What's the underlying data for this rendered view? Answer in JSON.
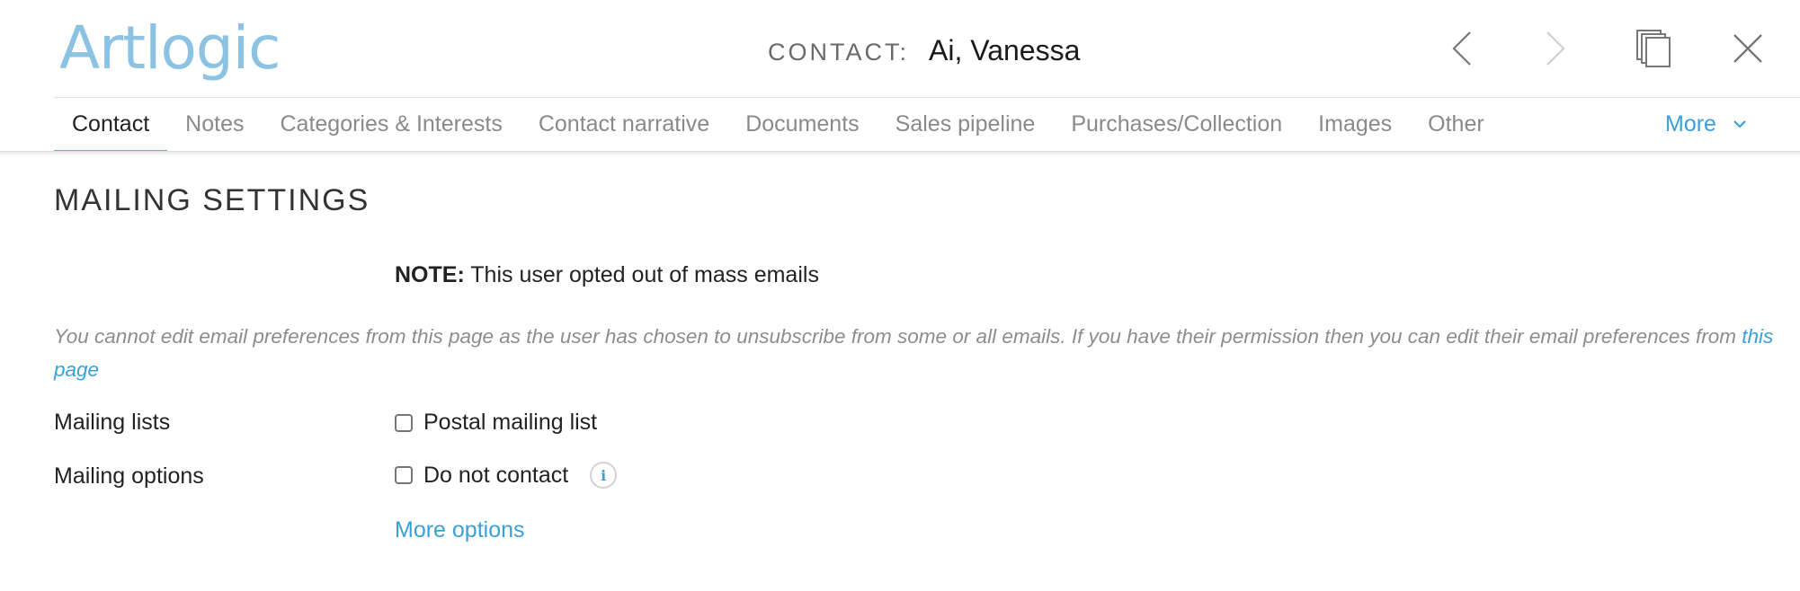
{
  "header": {
    "logo_text": "Artlogic",
    "contact_label": "CONTACT:",
    "contact_name": "Ai, Vanessa",
    "icons": [
      "chevron-left-icon",
      "chevron-right-icon",
      "duplicate-icon",
      "close-icon"
    ]
  },
  "tabs": [
    {
      "label": "Contact",
      "active": true
    },
    {
      "label": "Notes"
    },
    {
      "label": "Categories & Interests"
    },
    {
      "label": "Contact narrative"
    },
    {
      "label": "Documents"
    },
    {
      "label": "Sales pipeline"
    },
    {
      "label": "Purchases/Collection"
    },
    {
      "label": "Images"
    },
    {
      "label": "Other"
    }
  ],
  "more_tab": {
    "label": "More"
  },
  "mailing": {
    "section_title": "MAILING SETTINGS",
    "note_label": "NOTE:",
    "note_text": " This user opted out of mass emails",
    "explain_text": "You cannot edit email preferences from this page as the user has chosen to unsubscribe from some or all emails. If you have their permission then you can edit their email preferences from ",
    "explain_link": "this page",
    "lists_label": "Mailing lists",
    "postal_label": "Postal mailing list",
    "postal_checked": false,
    "options_label": "Mailing options",
    "do_not_contact_label": "Do not contact",
    "do_not_contact_checked": false,
    "info_icon_glyph": "i",
    "more_options": "More options"
  },
  "colors": {
    "accent": "#3aa0d8",
    "logo": "#8cc3e3",
    "muted_text": "#8d8d8d"
  }
}
